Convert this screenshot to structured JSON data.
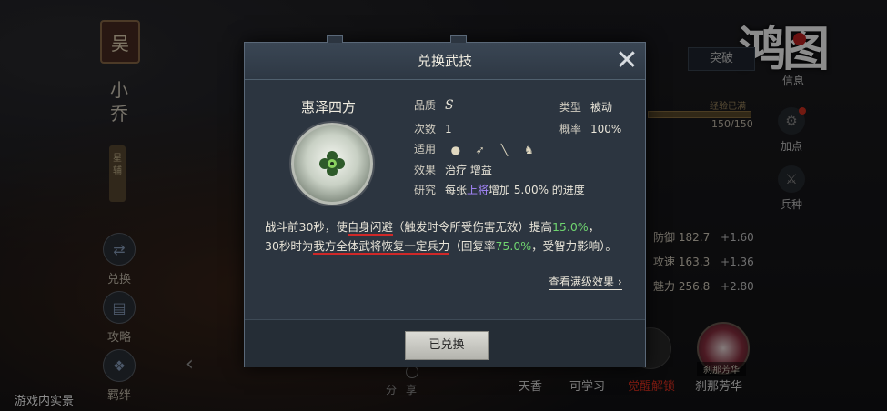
{
  "caption": "游戏内实景",
  "left_panel": {
    "clan": "吴",
    "hero_name": "小乔",
    "hero_tag": "星辅",
    "buttons": [
      {
        "label": "兑换"
      },
      {
        "label": "攻略"
      },
      {
        "label": "羁绊"
      }
    ]
  },
  "right_panel": {
    "logo": "鸿图",
    "breakthrough": "突破",
    "info": "信息",
    "exp_label": "经验已满",
    "exp_value": "150/150",
    "add_points": "加点",
    "troop": "兵种",
    "stats": [
      {
        "label": "防御",
        "value": "182.7",
        "plus": "+1.60"
      },
      {
        "label": "攻速",
        "value": "163.3",
        "plus": "+1.36"
      },
      {
        "label": "魅力",
        "value": "256.8",
        "plus": "+2.80"
      }
    ],
    "tabs": [
      "天香",
      "可学习",
      "觉醒解锁",
      "刹那芳华"
    ],
    "talent_name": "刹那芳华",
    "share": "分享"
  },
  "modal": {
    "title": "兑换武技",
    "skill_name": "惠泽四方",
    "quality_label": "品质",
    "quality_value": "S",
    "type_label": "类型",
    "type_value": "被动",
    "count_label": "次数",
    "count_value": "1",
    "chance_label": "概率",
    "chance_value": "100%",
    "applicable_label": "适用",
    "applicable_icons": [
      "shield-icon",
      "bow-icon",
      "spear-icon",
      "horse-icon"
    ],
    "effect_label": "效果",
    "effect_value": "治疗 增益",
    "research_label": "研究",
    "research_pre": "每张",
    "research_highlight": "上将",
    "research_post": "增加 5.00% 的进度",
    "desc": {
      "p1": "战斗前30秒，使",
      "p2": "自身闪避",
      "p3": "（触发时令所受伤害无效）提高",
      "p4": "15.0%",
      "p5": "，",
      "p6": "30秒时为",
      "p7": "我方全体武将恢复一定兵力",
      "p8": "（回复率",
      "p9": "75.0%",
      "p10": "，受智力影响）。"
    },
    "view_full": "查看满级效果",
    "redeemed_button": "已兑换"
  },
  "colors": {
    "modal_bg": "#2c3540",
    "highlight_green": "#6fd46f",
    "highlight_purple": "#a888ff",
    "underline_red": "#d02828"
  }
}
